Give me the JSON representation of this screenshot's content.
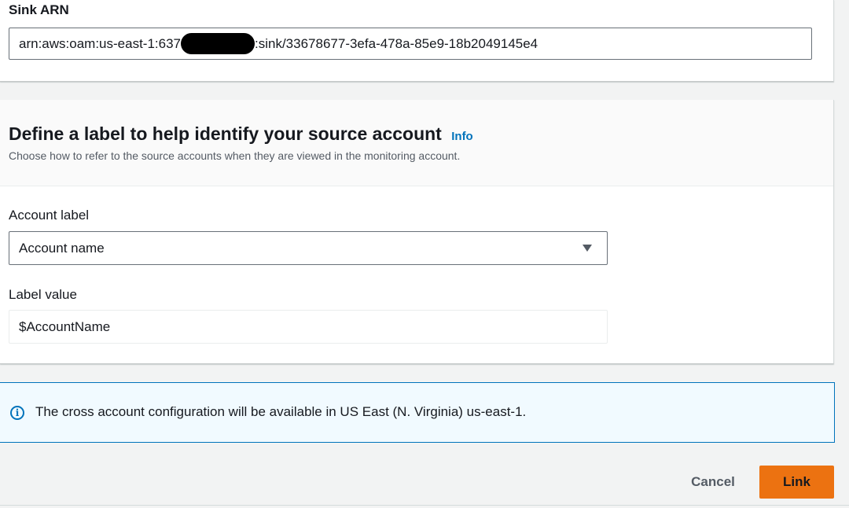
{
  "sink_section": {
    "label": "Sink ARN",
    "arn_prefix": "arn:aws:oam:us-east-1:637",
    "arn_suffix": ":sink/33678677-3efa-478a-85e9-18b2049145e4"
  },
  "label_section": {
    "title": "Define a label to help identify your source account",
    "info_link": "Info",
    "description": "Choose how to refer to the source accounts when they are viewed in the monitoring account.",
    "account_label": {
      "label": "Account label",
      "selected_value": "Account name"
    },
    "label_value": {
      "label": "Label value",
      "value": "$AccountName"
    }
  },
  "alert": {
    "icon": "info-icon",
    "text": "The cross account configuration will be available in US East (N. Virginia) us-east-1."
  },
  "footer": {
    "cancel_label": "Cancel",
    "link_label": "Link"
  },
  "colors": {
    "primary_button": "#ec7211",
    "info_blue": "#0073bb",
    "alert_background": "#f1faff"
  }
}
